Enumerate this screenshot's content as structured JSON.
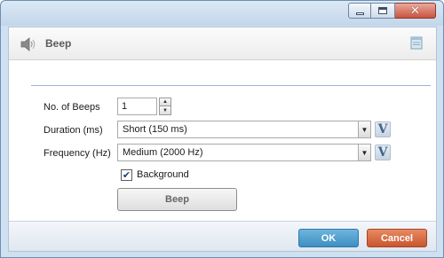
{
  "window": {
    "title": "Beep",
    "controls": {
      "minimize_icon": "minimize-icon",
      "maximize_icon": "maximize-icon",
      "close_icon": "close-icon",
      "close_glyph": "✕"
    }
  },
  "header": {
    "icon": "speaker-icon",
    "title": "Beep",
    "right_icon": "note-icon"
  },
  "form": {
    "beeps_label": "No. of Beeps",
    "beeps_value": "1",
    "duration_label": "Duration (ms)",
    "duration_value": "Short (150 ms)",
    "frequency_label": "Frequency (Hz)",
    "frequency_value": "Medium (2000 Hz)",
    "variable_glyph": "V",
    "background_label": "Background",
    "background_checked": true,
    "beep_button": "Beep"
  },
  "footer": {
    "ok_label": "OK",
    "cancel_label": "Cancel"
  },
  "colors": {
    "ok": "#3d8fc2",
    "cancel": "#c9562d",
    "separator": "#9bb4cf",
    "variable": "#45648a"
  }
}
